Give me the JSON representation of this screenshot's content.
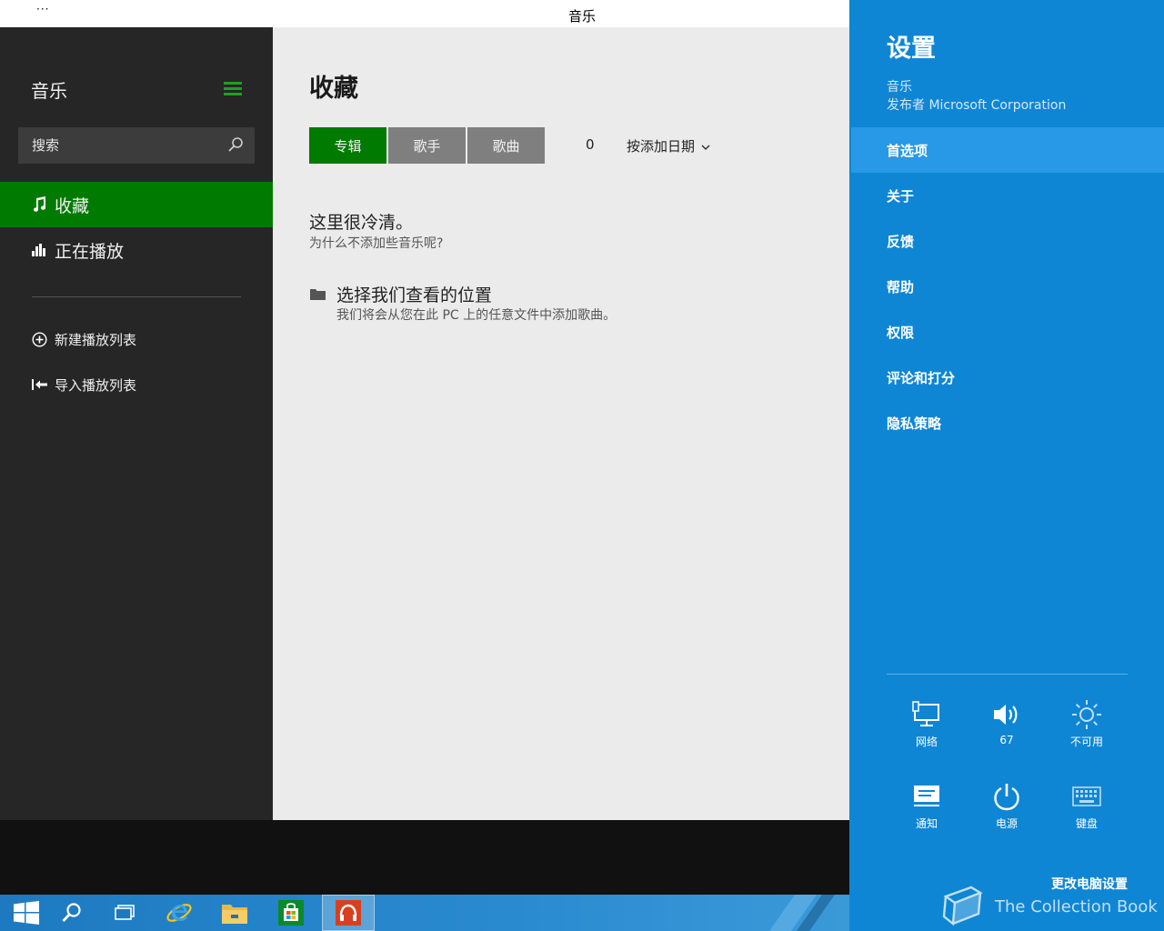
{
  "titlebar": {
    "menu_dots": "···",
    "title": "音乐"
  },
  "nav": {
    "app_name": "音乐",
    "search": {
      "placeholder": "搜索"
    },
    "items": [
      {
        "label": "收藏",
        "icon": "music-note-icon",
        "active": true
      },
      {
        "label": "正在播放",
        "icon": "equalizer-icon",
        "active": false
      }
    ],
    "actions": [
      {
        "label": "新建播放列表",
        "icon": "add-circle-icon"
      },
      {
        "label": "导入播放列表",
        "icon": "import-icon"
      }
    ]
  },
  "main": {
    "heading": "收藏",
    "tabs": [
      {
        "label": "专辑",
        "active": true
      },
      {
        "label": "歌手",
        "active": false
      },
      {
        "label": "歌曲",
        "active": false
      }
    ],
    "count": "0",
    "sort_label": "按添加日期",
    "empty": {
      "title": "这里很冷清。",
      "subtitle": "为什么不添加些音乐呢?"
    },
    "location": {
      "title": "选择我们查看的位置",
      "subtitle": "我们将会从您在此 PC 上的任意文件中添加歌曲。"
    }
  },
  "taskbar": {
    "buttons": [
      "start-icon",
      "search-icon",
      "task-view-icon",
      "internet-explorer-icon",
      "file-explorer-icon",
      "store-icon",
      "music-app-icon"
    ]
  },
  "charms": {
    "title": "设置",
    "app": "音乐",
    "publisher": "发布者 Microsoft Corporation",
    "items": [
      {
        "label": "首选项",
        "active": true
      },
      {
        "label": "关于",
        "active": false
      },
      {
        "label": "反馈",
        "active": false
      },
      {
        "label": "帮助",
        "active": false
      },
      {
        "label": "权限",
        "active": false
      },
      {
        "label": "评论和打分",
        "active": false
      },
      {
        "label": "隐私策略",
        "active": false
      }
    ],
    "quick": {
      "network": "网络",
      "volume": "67",
      "brightness": "不可用",
      "notifications": "通知",
      "power": "电源",
      "keyboard": "键盘"
    },
    "change_pc_settings": "更改电脑设置"
  },
  "watermark": "The Collection Book",
  "colors": {
    "accent_green": "#017a01",
    "charms_blue": "#0f86d4",
    "charms_active": "#2899e6",
    "nav_bg": "#262626"
  }
}
